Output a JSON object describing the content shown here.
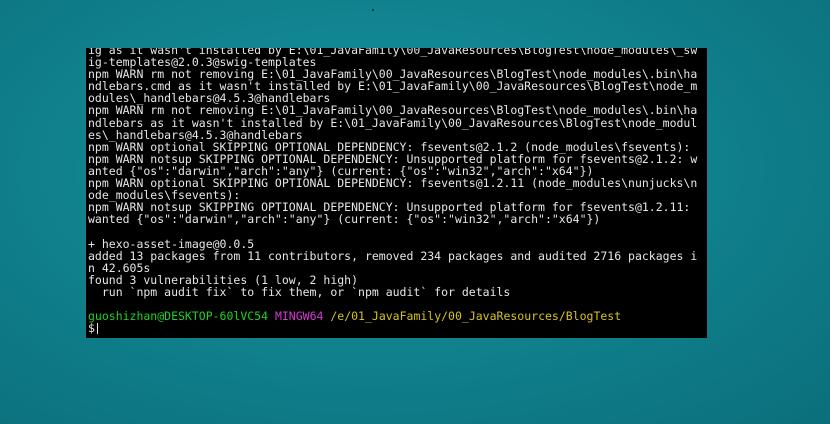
{
  "terminal": {
    "lines": [
      "ig as it wasn't installed by E:\\01_JavaFamily\\00_JavaResources\\BlogTest\\node_modules\\_sw",
      "ig-templates@2.0.3@swig-templates",
      "npm WARN rm not removing E:\\01_JavaFamily\\00_JavaResources\\BlogTest\\node_modules\\.bin\\ha",
      "ndlebars.cmd as it wasn't installed by E:\\01_JavaFamily\\00_JavaResources\\BlogTest\\node_m",
      "odules\\_handlebars@4.5.3@handlebars",
      "npm WARN rm not removing E:\\01_JavaFamily\\00_JavaResources\\BlogTest\\node_modules\\.bin\\ha",
      "ndlebars as it wasn't installed by E:\\01_JavaFamily\\00_JavaResources\\BlogTest\\node_modul",
      "es\\_handlebars@4.5.3@handlebars",
      "npm WARN optional SKIPPING OPTIONAL DEPENDENCY: fsevents@2.1.2 (node_modules\\fsevents):",
      "npm WARN notsup SKIPPING OPTIONAL DEPENDENCY: Unsupported platform for fsevents@2.1.2: w",
      "anted {\"os\":\"darwin\",\"arch\":\"any\"} (current: {\"os\":\"win32\",\"arch\":\"x64\"})",
      "npm WARN optional SKIPPING OPTIONAL DEPENDENCY: fsevents@1.2.11 (node_modules\\nunjucks\\n",
      "ode_modules\\fsevents):",
      "npm WARN notsup SKIPPING OPTIONAL DEPENDENCY: Unsupported platform for fsevents@1.2.11:",
      "wanted {\"os\":\"darwin\",\"arch\":\"any\"} (current: {\"os\":\"win32\",\"arch\":\"x64\"})",
      "",
      "+ hexo-asset-image@0.0.5",
      "added 13 packages from 11 contributors, removed 234 packages and audited 2716 packages i",
      "n 42.605s",
      "found 3 vulnerabilities (1 low, 2 high)",
      "  run `npm audit fix` to fix them, or `npm audit` for details",
      ""
    ],
    "prompt": {
      "user_host": "guoshizhan@DESKTOP-60lVC54",
      "env": "MINGW64",
      "path": "/e/01_JavaFamily/00_JavaResources/BlogTest",
      "symbol": "$"
    },
    "colors": {
      "background": "#000000",
      "text": "#e6e6e6",
      "user_host": "#1fd321",
      "env": "#d33bd3",
      "path": "#d6c21f"
    }
  }
}
